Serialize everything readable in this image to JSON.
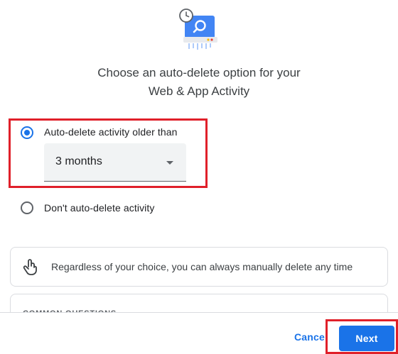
{
  "header": {
    "title_line1": "Choose an auto-delete option for your",
    "title_line2": "Web & App Activity"
  },
  "options": {
    "auto_delete": {
      "label": "Auto-delete activity older than",
      "selected": true
    },
    "dont_auto_delete": {
      "label": "Don't auto-delete activity",
      "selected": false
    }
  },
  "duration_select": {
    "value": "3 months"
  },
  "info": {
    "text": "Regardless of your choice, you can always manually delete any time",
    "icon": "touch-hand-icon"
  },
  "faq": {
    "title": "COMMON QUESTIONS"
  },
  "footer": {
    "cancel_label": "Cancel",
    "next_label": "Next"
  },
  "colors": {
    "accent": "#1a73e8",
    "highlight": "#e0202a"
  }
}
